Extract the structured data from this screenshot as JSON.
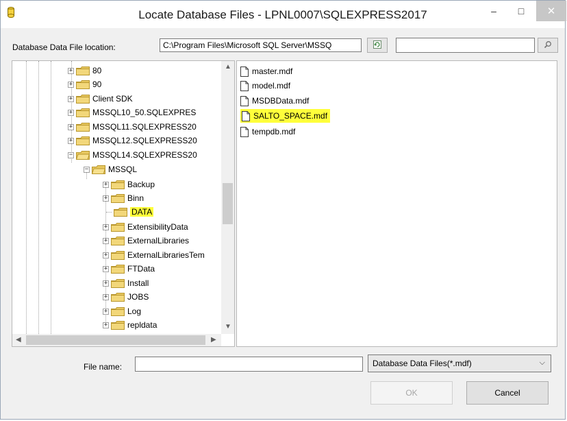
{
  "window": {
    "title": "Locate Database Files - LPNL0007\\SQLEXPRESS2017",
    "minimize": "–",
    "maximize": "□",
    "close": "✕"
  },
  "location": {
    "label": "Database Data File location:",
    "path": "C:\\Program Files\\Microsoft SQL Server\\MSSQ",
    "search_value": ""
  },
  "tree": {
    "items": [
      {
        "label": "80",
        "expander": "+"
      },
      {
        "label": "90",
        "expander": "+"
      },
      {
        "label": "Client SDK",
        "expander": "+"
      },
      {
        "label": "MSSQL10_50.SQLEXPRES",
        "expander": "+"
      },
      {
        "label": "MSSQL11.SQLEXPRESS20",
        "expander": "+"
      },
      {
        "label": "MSSQL12.SQLEXPRESS20",
        "expander": "+"
      },
      {
        "label": "MSSQL14.SQLEXPRESS20",
        "expander": "−"
      },
      {
        "label": "MSSQL",
        "expander": "−"
      },
      {
        "label": "Backup",
        "expander": "+"
      },
      {
        "label": "Binn",
        "expander": "+"
      },
      {
        "label": "DATA",
        "expander": ""
      },
      {
        "label": "ExtensibilityData",
        "expander": "+"
      },
      {
        "label": "ExternalLibraries",
        "expander": "+"
      },
      {
        "label": "ExternalLibrariesTem",
        "expander": "+"
      },
      {
        "label": "FTData",
        "expander": "+"
      },
      {
        "label": "Install",
        "expander": "+"
      },
      {
        "label": "JOBS",
        "expander": "+"
      },
      {
        "label": "Log",
        "expander": "+"
      },
      {
        "label": "repldata",
        "expander": "+"
      }
    ]
  },
  "files": {
    "items": [
      {
        "label": "master.mdf"
      },
      {
        "label": "model.mdf"
      },
      {
        "label": "MSDBData.mdf"
      },
      {
        "label": "SALTO_SPACE.mdf"
      },
      {
        "label": "tempdb.mdf"
      }
    ]
  },
  "footer": {
    "file_name_label": "File name:",
    "file_name_value": "",
    "filter": "Database Data Files(*.mdf)",
    "ok_label": "OK",
    "cancel_label": "Cancel"
  },
  "colors": {
    "highlight": "#ffff3b",
    "folder": "#e8c860"
  }
}
